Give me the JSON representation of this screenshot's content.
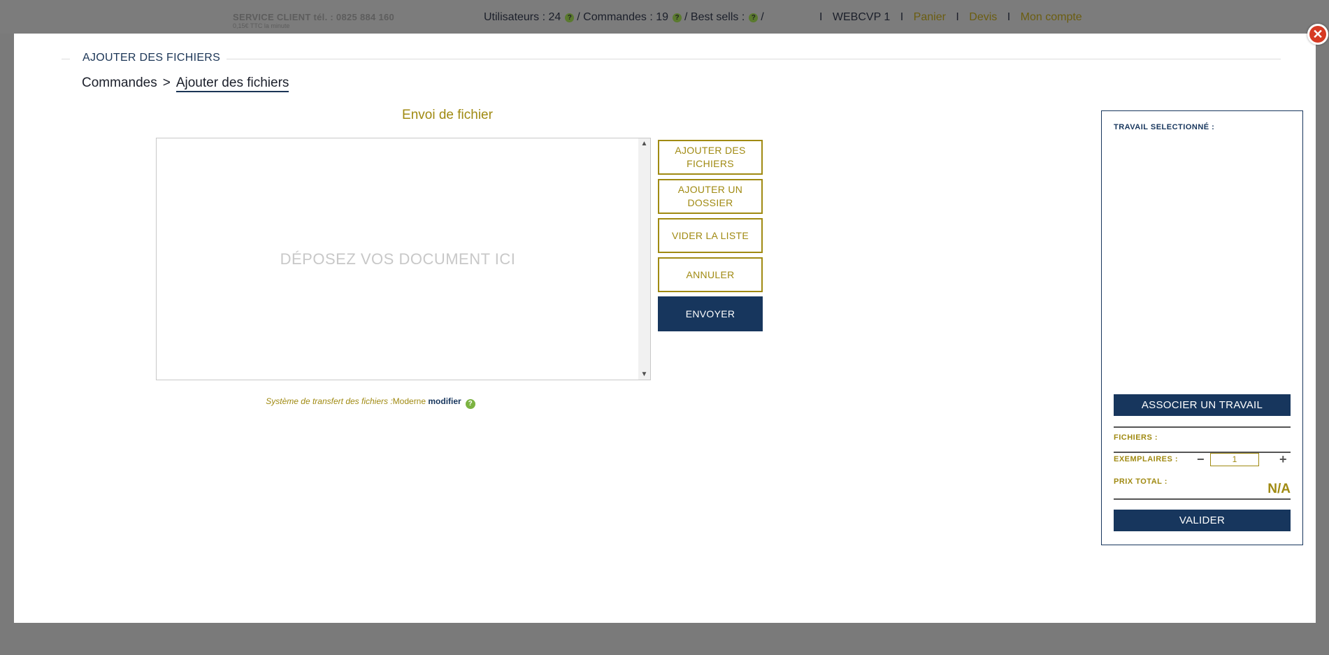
{
  "topbar": {
    "service_label": "SERVICE CLIENT tél. :  0825 884 160",
    "service_sub": "0,15€ TTC la minute",
    "users": "Utilisateurs : 24",
    "orders": "Commandes : 19",
    "best_sells": "Best sells :",
    "slash": "/",
    "help_glyph": "?",
    "user": "WEBCVP 1",
    "cart": "Panier",
    "quote": "Devis",
    "account": "Mon compte",
    "sep": "I"
  },
  "modal": {
    "close_glyph": "✕",
    "title": "AJOUTER DES FICHIERS",
    "breadcrumb": [
      "Commandes",
      "Ajouter des fichiers"
    ],
    "breadcrumb_sep": ">"
  },
  "upload": {
    "heading": "Envoi de fichier",
    "drop_text": "DÉPOSEZ VOS DOCUMENT ICI",
    "scroll_up": "▲",
    "scroll_down": "▼",
    "buttons": {
      "add_files": "AJOUTER DES FICHIERS",
      "add_folder": "AJOUTER UN DOSSIER",
      "clear": "VIDER LA LISTE",
      "cancel": "ANNULER",
      "send": "ENVOYER"
    },
    "transfer_label": "Système de transfert des fichiers :",
    "transfer_mode": "Moderne",
    "transfer_modify": "modifier",
    "help_glyph": "?"
  },
  "panel": {
    "title": "TRAVAIL SELECTIONNÉ :",
    "associate": "ASSOCIER UN TRAVAIL",
    "files_label": "FICHIERS :",
    "copies_label": "EXEMPLAIRES :",
    "copies_value": "1",
    "minus": "−",
    "plus": "+",
    "total_label": "PRIX TOTAL :",
    "total_value": "N/A",
    "validate": "VALIDER"
  },
  "colors": {
    "navy": "#17365d",
    "gold": "#a08a12",
    "close_red": "#d63a23"
  }
}
